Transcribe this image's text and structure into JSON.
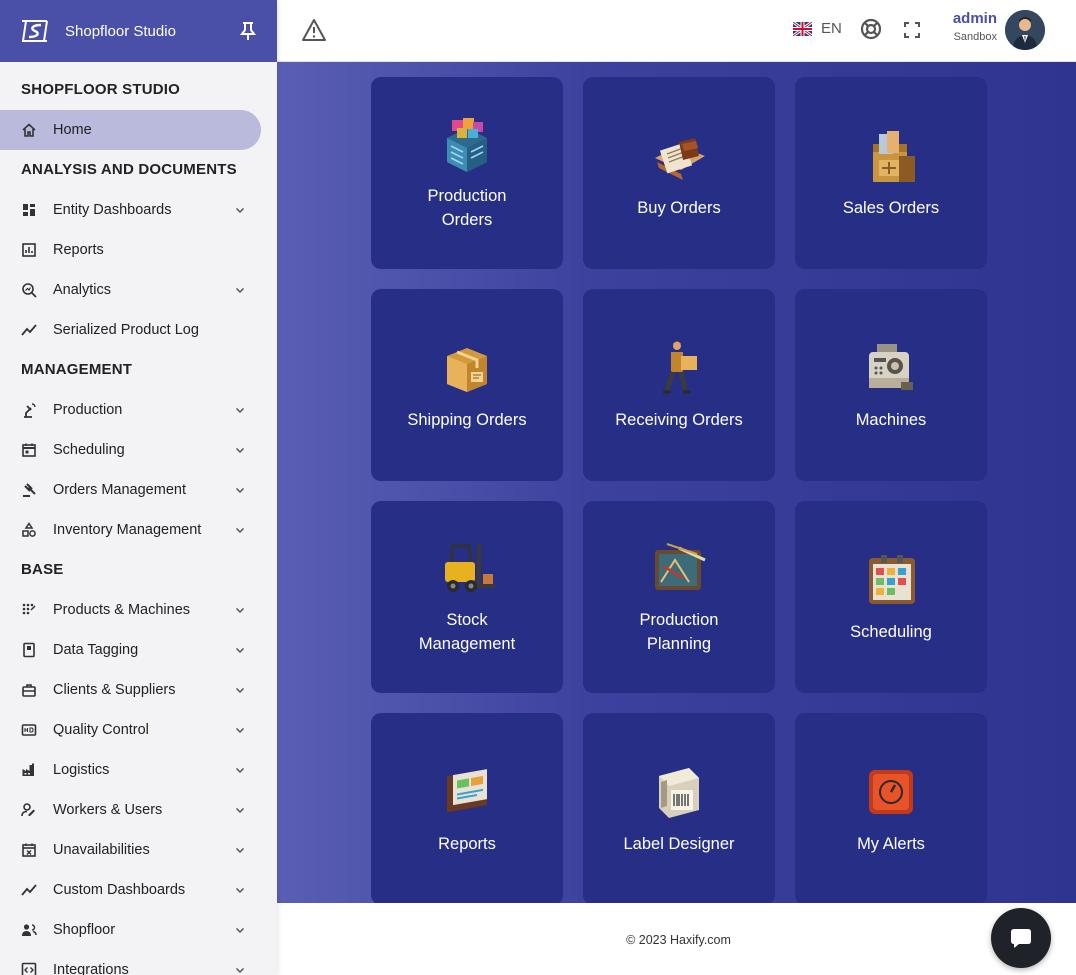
{
  "brand": {
    "name": "Shopfloor Studio"
  },
  "sidebar": {
    "sections": [
      {
        "title": "SHOPFLOOR STUDIO",
        "items": [
          {
            "label": "Home",
            "icon": "home-icon",
            "active": true,
            "expandable": false
          }
        ]
      },
      {
        "title": "ANALYSIS AND DOCUMENTS",
        "items": [
          {
            "label": "Entity Dashboards",
            "icon": "dashboard-icon",
            "expandable": true
          },
          {
            "label": "Reports",
            "icon": "report-icon",
            "expandable": false
          },
          {
            "label": "Analytics",
            "icon": "analytics-icon",
            "expandable": true
          },
          {
            "label": "Serialized Product Log",
            "icon": "trend-icon",
            "expandable": false
          }
        ]
      },
      {
        "title": "MANAGEMENT",
        "items": [
          {
            "label": "Production",
            "icon": "robot-arm-icon",
            "expandable": true
          },
          {
            "label": "Scheduling",
            "icon": "calendar-icon",
            "expandable": true
          },
          {
            "label": "Orders Management",
            "icon": "gavel-icon",
            "expandable": true
          },
          {
            "label": "Inventory Management",
            "icon": "shapes-icon",
            "expandable": true
          }
        ]
      },
      {
        "title": "BASE",
        "items": [
          {
            "label": "Products & Machines",
            "icon": "grid-dots-icon",
            "expandable": true
          },
          {
            "label": "Data Tagging",
            "icon": "tag-icon",
            "expandable": true
          },
          {
            "label": "Clients & Suppliers",
            "icon": "briefcase-icon",
            "expandable": true
          },
          {
            "label": "Quality Control",
            "icon": "hd-icon",
            "expandable": true
          },
          {
            "label": "Logistics",
            "icon": "factory-icon",
            "expandable": true
          },
          {
            "label": "Workers & Users",
            "icon": "user-edit-icon",
            "expandable": true
          },
          {
            "label": "Unavailabilities",
            "icon": "calendar-x-icon",
            "expandable": true
          },
          {
            "label": "Custom Dashboards",
            "icon": "trend-icon",
            "expandable": true
          },
          {
            "label": "Shopfloor",
            "icon": "people-icon",
            "expandable": true
          },
          {
            "label": "Integrations",
            "icon": "code-icon",
            "expandable": true
          }
        ]
      }
    ]
  },
  "topbar": {
    "language": "EN",
    "user": {
      "name": "admin",
      "role": "Sandbox"
    }
  },
  "tiles": [
    {
      "label": "Production\nOrders",
      "icon": "production-orders-icon"
    },
    {
      "label": "Buy Orders",
      "icon": "buy-orders-icon"
    },
    {
      "label": "Sales Orders",
      "icon": "sales-orders-icon"
    },
    {
      "label": "Shipping Orders",
      "icon": "shipping-orders-icon"
    },
    {
      "label": "Receiving Orders",
      "icon": "receiving-orders-icon"
    },
    {
      "label": "Machines",
      "icon": "machines-icon"
    },
    {
      "label": "Stock\nManagement",
      "icon": "forklift-icon"
    },
    {
      "label": "Production\nPlanning",
      "icon": "planning-icon"
    },
    {
      "label": "Scheduling",
      "icon": "scheduling-board-icon"
    },
    {
      "label": "Reports",
      "icon": "reports-icon"
    },
    {
      "label": "Label Designer",
      "icon": "label-designer-icon"
    },
    {
      "label": "My Alerts",
      "icon": "alerts-icon"
    }
  ],
  "footer": {
    "copyright": "© 2023 Haxify.com"
  },
  "colors": {
    "brand": "#4a4fa8",
    "tile": "#272e86",
    "active_nav": "#b9badc"
  }
}
